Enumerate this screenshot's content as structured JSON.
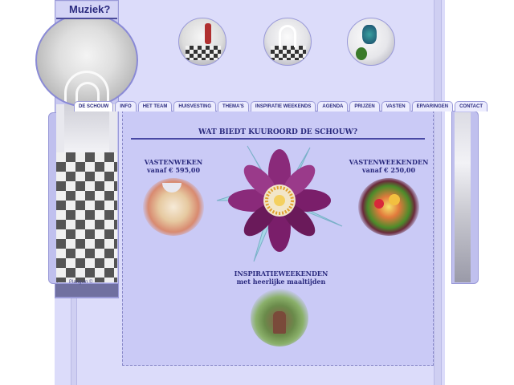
{
  "header": {
    "music_button": "Muziek?"
  },
  "nav": {
    "tabs": [
      {
        "label": "DE SCHOUW",
        "active": true
      },
      {
        "label": "INFO"
      },
      {
        "label": "HET TEAM"
      },
      {
        "label": "HUISVESTING"
      },
      {
        "label": "THEMA'S"
      },
      {
        "label": "INSPIRATIE WEEKENDS"
      },
      {
        "label": "AGENDA"
      },
      {
        "label": "PRIJZEN"
      },
      {
        "label": "VASTEN"
      },
      {
        "label": "ERVARINGEN"
      },
      {
        "label": "CONTACT"
      }
    ]
  },
  "main": {
    "title": "WAT BIEDT KUUROORD DE SCHOUW?",
    "vastenweken": {
      "line1": "VASTENWEKEN",
      "line2": "vanaf € 595,00"
    },
    "vastenweekenden": {
      "line1": "VASTENWEEKENDEN",
      "line2": "vanaf € 250,00"
    },
    "inspiratie": {
      "line1": "INSPIRATIEWEEKENDEN",
      "line2": "met heerlijke maaltijden"
    }
  },
  "left_panel": {
    "small_text": "Planguin ©"
  },
  "icons": [
    "lotus-flower-icon"
  ],
  "colors": {
    "accent": "#2a2a7e",
    "panel": "#cacaf6",
    "backdrop": "#dcdcfa",
    "border": "#9a9ad8"
  }
}
